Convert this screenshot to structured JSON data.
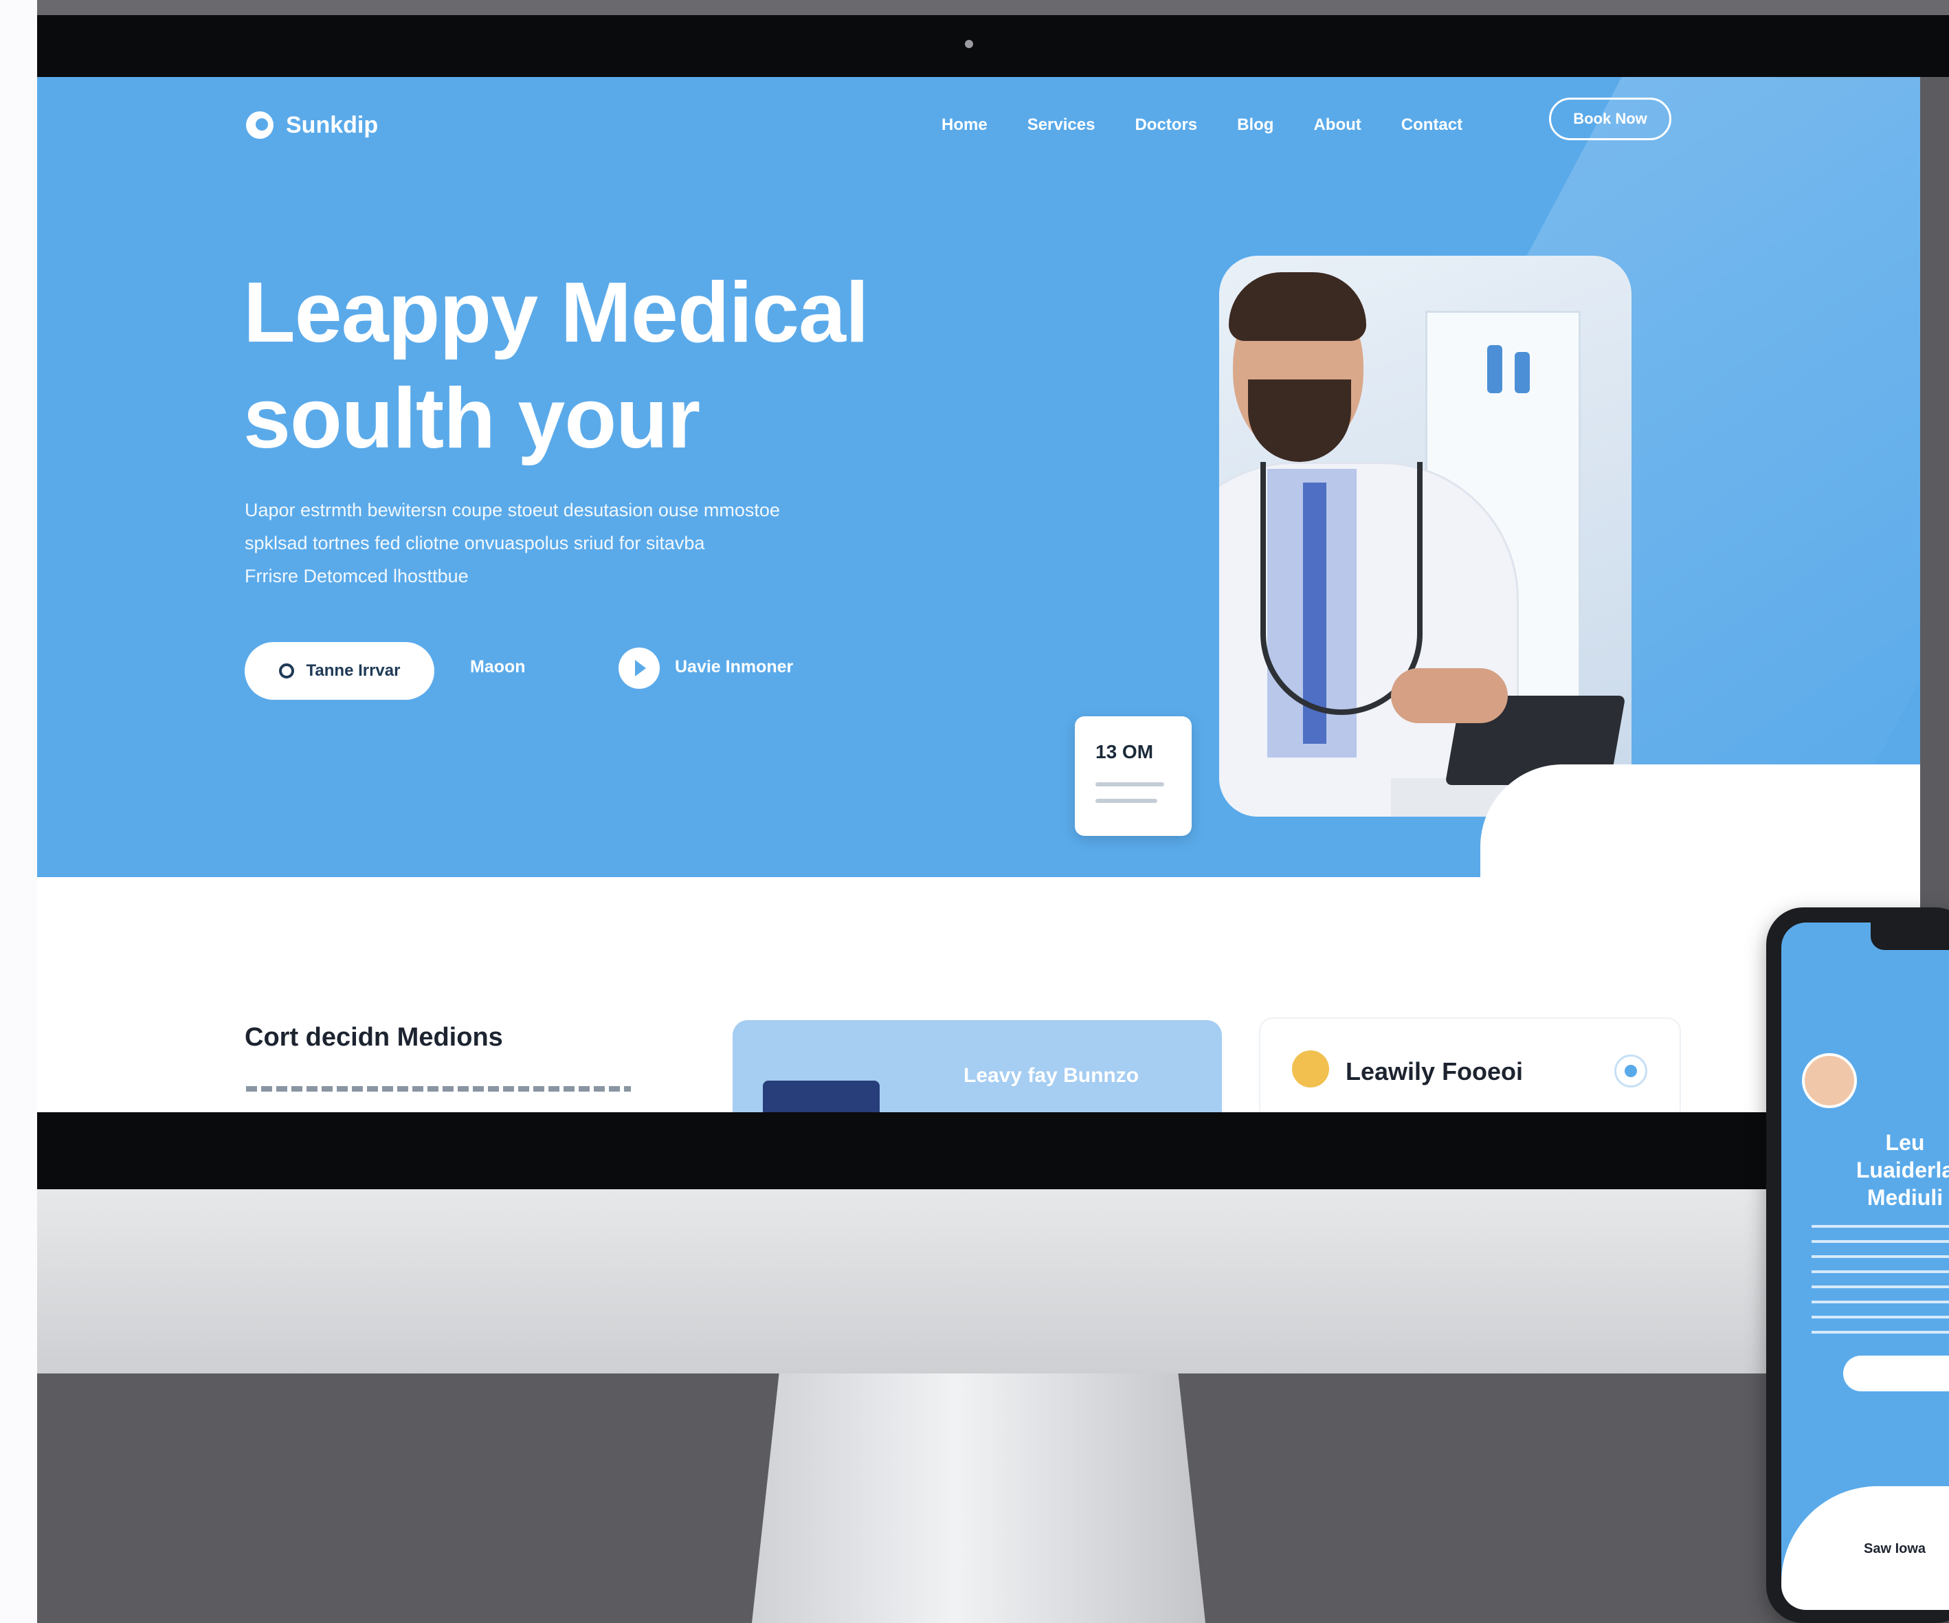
{
  "brand": {
    "name": "Sunkdip"
  },
  "nav": {
    "items": [
      "Home",
      "Services",
      "Doctors",
      "Blog",
      "About",
      "Contact"
    ],
    "cta": "Book Now"
  },
  "hero": {
    "title_line1": "Leappy Medical",
    "title_line2": "soulth your",
    "body_lines": [
      "Uapor estrmth bewitersn coupe stoeut desutasion ouse mmostoe",
      "spklsad tortnes fed cliotne onvuaspolus sriud for sitavba",
      "Frrisre Detomced lhosttbue"
    ],
    "primary_button": "Tanne Irrvar",
    "secondary_link": "Maoon",
    "video_label": "Uavie Inmoner"
  },
  "stat_card": {
    "value": "13 OM"
  },
  "section": {
    "title": "Cort decidn Medions",
    "feature_card_title": "Leavy fay Bunnzo",
    "info_card_name": "Leawily Fooeoi"
  },
  "phone": {
    "headline_lines": [
      "Leu",
      "Luaiderla",
      "Mediuli"
    ],
    "bottom_label": "Saw Iowa"
  },
  "colors": {
    "hero_blue": "#5aaaea",
    "dark_text": "#1d2430",
    "white": "#ffffff"
  }
}
